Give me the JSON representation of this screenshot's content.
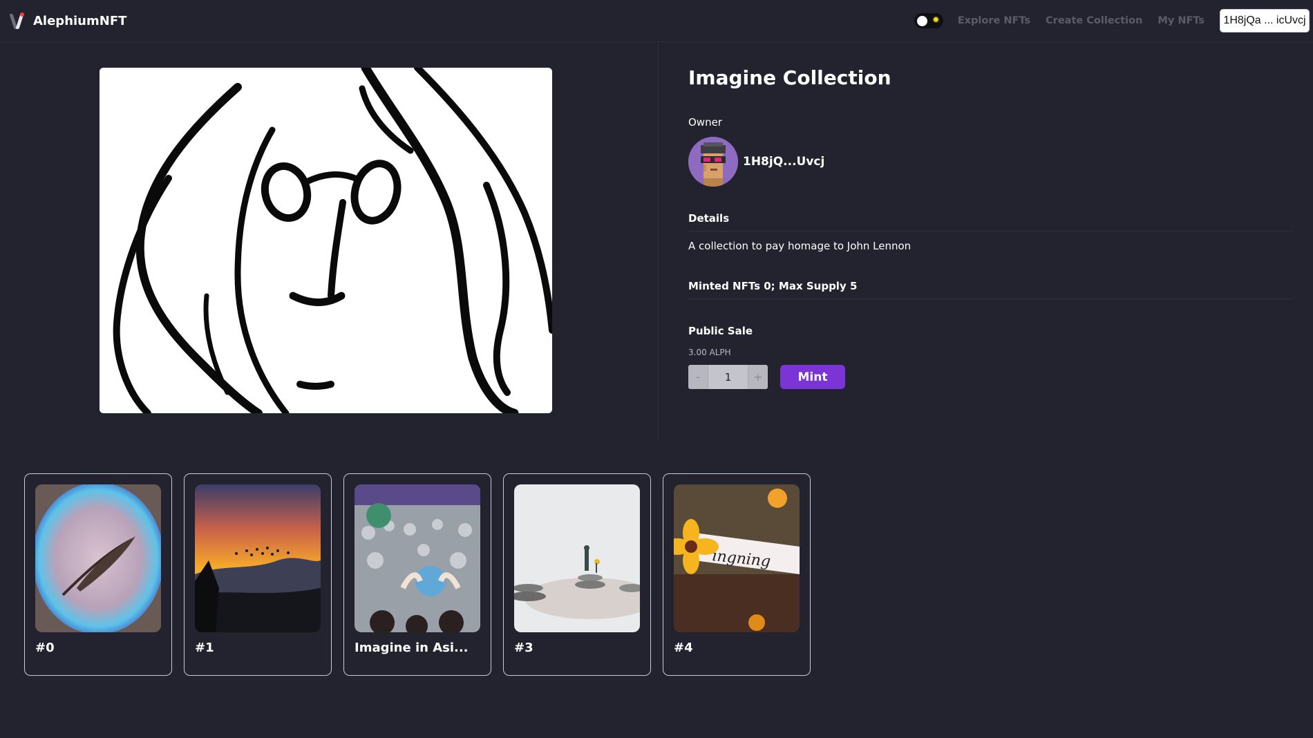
{
  "navbar": {
    "brand": "AlephiumNFT",
    "links": [
      "Explore NFTs",
      "Create Collection",
      "My NFTs"
    ],
    "wallet": "1H8jQa ... icUvcj",
    "toggle_icon": "sun-icon"
  },
  "collection": {
    "title": "Imagine Collection",
    "owner_label": "Owner",
    "owner_address": "1H8jQ...Uvcj",
    "details_label": "Details",
    "description": "A collection to pay homage to John Lennon",
    "supply_text": "Minted NFTs 0; Max Supply 5",
    "sale_label": "Public Sale",
    "price": "3.00 ALPH",
    "quantity": "1",
    "decrement": "-",
    "increment": "+",
    "mint_label": "Mint"
  },
  "nfts": [
    {
      "label": "#0",
      "image": "feather-bubble-image"
    },
    {
      "label": "#1",
      "image": "sunset-birds-image"
    },
    {
      "label": "Imagine in Asi...",
      "image": "crowd-globe-image"
    },
    {
      "label": "#3",
      "image": "figure-stones-image"
    },
    {
      "label": "#4",
      "image": "flower-note-image"
    }
  ],
  "colors": {
    "background": "#22232e",
    "accent": "#7b35d6",
    "avatar_bg": "#8e6bc0"
  }
}
